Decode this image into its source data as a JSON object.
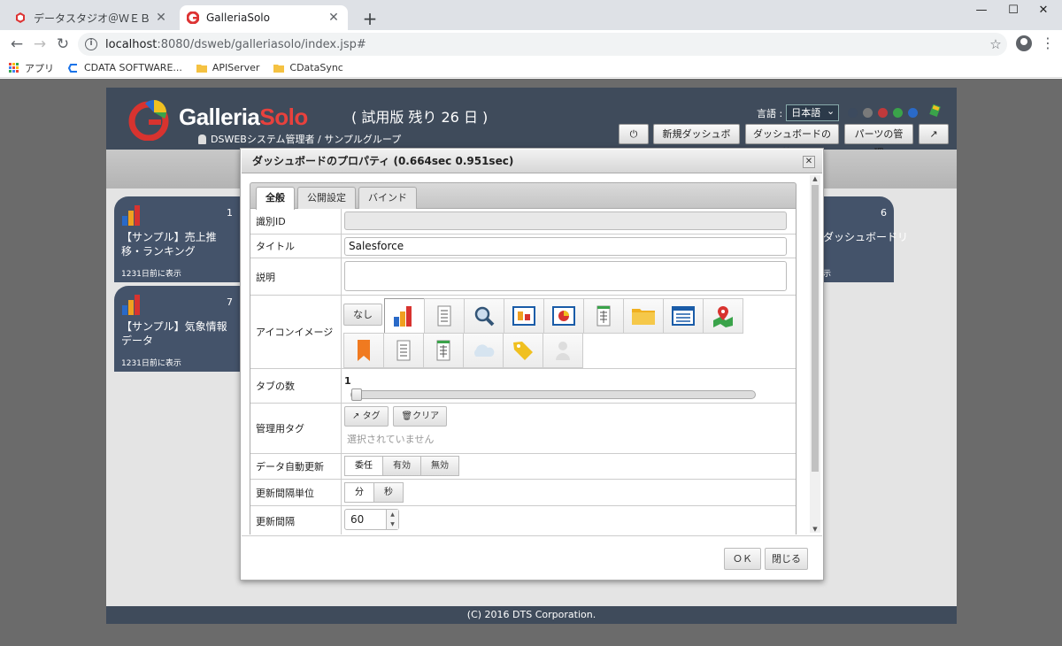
{
  "browser": {
    "tabs": [
      {
        "title": "データスタジオ＠ＷＥＢ　ログイン画面"
      },
      {
        "title": "GalleriaSolo"
      }
    ],
    "url_host": "localhost",
    "url_rest": ":8080/dsweb/galleriasolo/index.jsp#",
    "bookmarks": [
      "アプリ",
      "CDATA SOFTWARE...",
      "APIServer",
      "CDataSync"
    ]
  },
  "header": {
    "logo_main": "Galleria",
    "logo_accent": "Solo",
    "trial": "( 試用版 残り 26 日 )",
    "user": "DSWEBシステム管理者 / サンプルグループ",
    "lang_label": "言語 :",
    "lang_value": "日本語",
    "theme_colors": [
      "#3c4a5e",
      "#7a7a7a",
      "#c0393b",
      "#3aa34a",
      "#2a6ac8"
    ],
    "buttons": {
      "new_dashboard": "新規ダッシュボード",
      "manage_dashboard": "ダッシュボードの管理",
      "manage_parts": "パーツの管理"
    }
  },
  "cards": [
    {
      "num": "1",
      "title": "【サンプル】売上推移・ランキング",
      "foot": "1231日前に表示"
    },
    {
      "num": "7",
      "title": "【サンプル】気象情報データ",
      "foot": "1231日前に表示"
    },
    {
      "num": "6",
      "title": "ダッシュボードリ",
      "foot": "示"
    }
  ],
  "footer": "(C) 2016 DTS Corporation.",
  "dialog": {
    "title": "ダッシュボードのプロパティ (0.664sec 0.951sec)",
    "tabs": [
      "全般",
      "公開設定",
      "バインド"
    ],
    "fields": {
      "id_label": "識別ID",
      "title_label": "タイトル",
      "title_value": "Salesforce",
      "desc_label": "説明",
      "icon_label": "アイコンイメージ",
      "icon_none": "なし",
      "tabs_label": "タブの数",
      "tabs_value": "1",
      "tag_label": "管理用タグ",
      "tag_button": "タグ",
      "clear_button": "クリア",
      "tag_hint": "選択されていません",
      "auto_label": "データ自動更新",
      "auto_options": [
        "委任",
        "有効",
        "無効"
      ],
      "unit_label": "更新間隔単位",
      "unit_options": [
        "分",
        "秒"
      ],
      "interval_label": "更新間隔",
      "interval_value": "60"
    },
    "ok": "ＯＫ",
    "close": "閉じる"
  }
}
